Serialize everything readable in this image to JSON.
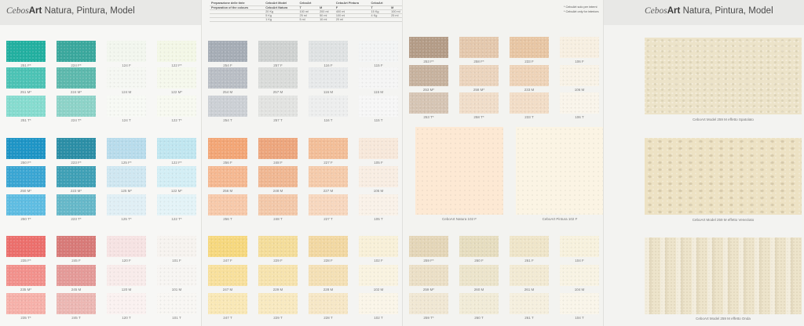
{
  "brand": {
    "logo": "Cebos",
    "art": "Art",
    "rest": " Natura, Pintura, Model"
  },
  "prep": {
    "rows": [
      [
        "Preparazione delle tinte",
        "CeboArt Model",
        "CeboArt",
        "",
        "CeboArt Pintura",
        "CeboArt",
        ""
      ],
      [
        "Preparation of the colours",
        "CeboArt Natura",
        "T",
        "M",
        "F",
        "T",
        "M"
      ],
      [
        "",
        "20 Kg",
        "100 ml",
        "200 ml",
        "400 ml",
        "15 Kg",
        "100 ml"
      ],
      [
        "",
        "5 Kg",
        "25 ml",
        "50 ml",
        "100 ml",
        "4 Kg",
        "25 ml"
      ],
      [
        "",
        "1 Kg",
        "5 ml",
        "10 ml",
        "20 ml",
        "",
        ""
      ]
    ]
  },
  "notes": [
    "* CeboArt solo per interni",
    "* CeboArt only for interiors"
  ],
  "panel1": [
    {
      "c": "251 F*",
      "col": "#22b0a0"
    },
    {
      "c": "224 F*",
      "col": "#3aa89d"
    },
    {
      "c": "124 F",
      "col": "#f2f6ee"
    },
    {
      "c": "122 F*",
      "col": "#f3f7e6"
    },
    {
      "c": "251 M*",
      "col": "#4cc3b5"
    },
    {
      "c": "224 M*",
      "col": "#5db9ad"
    },
    {
      "c": "124 M",
      "col": "#f5f7f2"
    },
    {
      "c": "122 M*",
      "col": "#f5f8ec"
    },
    {
      "c": "251 T*",
      "col": "#86dccf"
    },
    {
      "c": "224 T*",
      "col": "#8dd3c8"
    },
    {
      "c": "124 T",
      "col": "#f7f9f4"
    },
    {
      "c": "122 T*",
      "col": "#f7f9f0"
    },
    {
      "c": "250 F*",
      "col": "#1e95c6"
    },
    {
      "c": "223 F*",
      "col": "#2b8ea6"
    },
    {
      "c": "125 F*",
      "col": "#b8dcec"
    },
    {
      "c": "122 F*",
      "col": "#c0e6f0"
    },
    {
      "c": "250 M*",
      "col": "#3aa6d3"
    },
    {
      "c": "223 M*",
      "col": "#3fa0b6"
    },
    {
      "c": "125 M*",
      "col": "#cfe7f1"
    },
    {
      "c": "122 M*",
      "col": "#d3eef5"
    },
    {
      "c": "250 T*",
      "col": "#5fbde2"
    },
    {
      "c": "223 T*",
      "col": "#66b8c9"
    },
    {
      "c": "125 T*",
      "col": "#e0eff5"
    },
    {
      "c": "122 T*",
      "col": "#e3f3f7"
    },
    {
      "c": "235 F*",
      "col": "#ec6f6c"
    },
    {
      "c": "245 F",
      "col": "#d87a78"
    },
    {
      "c": "120 F",
      "col": "#f6e3e3"
    },
    {
      "c": "101 F",
      "col": "#f6f3ef"
    },
    {
      "c": "235 M*",
      "col": "#f2918c"
    },
    {
      "c": "245 M",
      "col": "#e49a98"
    },
    {
      "c": "120 M",
      "col": "#f8ebea"
    },
    {
      "c": "101 M",
      "col": "#f7f5f2"
    },
    {
      "c": "235 T*",
      "col": "#f6b1aa"
    },
    {
      "c": "245 T",
      "col": "#ecb7b3"
    },
    {
      "c": "120 T",
      "col": "#faf1f0"
    },
    {
      "c": "101 T",
      "col": "#f8f6f3"
    }
  ],
  "panel2": [
    {
      "c": "254 F",
      "col": "#a6adb6"
    },
    {
      "c": "257 F",
      "col": "#cfd2d1"
    },
    {
      "c": "116 F",
      "col": "#dfe2e3"
    },
    {
      "c": "115 F",
      "col": "#f3f4f4"
    },
    {
      "c": "254 M",
      "col": "#b9bec5"
    },
    {
      "c": "257 M",
      "col": "#dadcda"
    },
    {
      "c": "116 M",
      "col": "#e7e9ea"
    },
    {
      "c": "115 M",
      "col": "#f5f5f5"
    },
    {
      "c": "254 T",
      "col": "#ccd0d5"
    },
    {
      "c": "257 T",
      "col": "#e2e3e1"
    },
    {
      "c": "116 T",
      "col": "#edeeee"
    },
    {
      "c": "115 T",
      "col": "#f6f6f6"
    },
    {
      "c": "256 F",
      "col": "#f3a676"
    },
    {
      "c": "248 F",
      "col": "#eda67d"
    },
    {
      "c": "227 F",
      "col": "#f3be98"
    },
    {
      "c": "105 F",
      "col": "#f7e8da"
    },
    {
      "c": "256 M",
      "col": "#f5b891"
    },
    {
      "c": "248 M",
      "col": "#f0b792"
    },
    {
      "c": "227 M",
      "col": "#f5cbab"
    },
    {
      "c": "105 M",
      "col": "#f8ede2"
    },
    {
      "c": "256 T",
      "col": "#f7c9aa"
    },
    {
      "c": "248 T",
      "col": "#f3c8a9"
    },
    {
      "c": "227 T",
      "col": "#f7d7be"
    },
    {
      "c": "105 T",
      "col": "#f9f1e8"
    },
    {
      "c": "247 F",
      "col": "#f6d87e"
    },
    {
      "c": "229 F",
      "col": "#f4dd9a"
    },
    {
      "c": "228 F",
      "col": "#f2d8a2"
    },
    {
      "c": "102 F",
      "col": "#f8f0d8"
    },
    {
      "c": "247 M",
      "col": "#f8e09c"
    },
    {
      "c": "229 M",
      "col": "#f6e3ae"
    },
    {
      "c": "228 M",
      "col": "#f4e0b5"
    },
    {
      "c": "102 M",
      "col": "#f9f3e0"
    },
    {
      "c": "247 T",
      "col": "#f9e8b6"
    },
    {
      "c": "229 T",
      "col": "#f8e9c0"
    },
    {
      "c": "228 T",
      "col": "#f6e7c6"
    },
    {
      "c": "102 T",
      "col": "#faf5e8"
    }
  ],
  "panel3_top": [
    {
      "c": "253 F*",
      "col": "#b49c87"
    },
    {
      "c": "258 F*",
      "col": "#e4c8ad"
    },
    {
      "c": "233 F",
      "col": "#e8c6a4"
    },
    {
      "c": "106 F",
      "col": "#f7efe1"
    },
    {
      "c": "253 M*",
      "col": "#c7b29e"
    },
    {
      "c": "258 M*",
      "col": "#ebd4bd"
    },
    {
      "c": "233 M",
      "col": "#eed3b8"
    },
    {
      "c": "106 M",
      "col": "#f8f2e6"
    },
    {
      "c": "253 T*",
      "col": "#d6c5b4"
    },
    {
      "c": "258 T*",
      "col": "#f0ddc9"
    },
    {
      "c": "233 T",
      "col": "#f2ddc7"
    },
    {
      "c": "106 T",
      "col": "#f9f4ea"
    }
  ],
  "panel3_big": [
    {
      "c": "CeboArt Natura 102 F",
      "col": "#fde9d4"
    },
    {
      "c": "CeboArt Pintura 102 F",
      "col": "#fbf4e4"
    }
  ],
  "panel3_bottom": [
    {
      "c": "259 F*",
      "col": "#e4d6b8"
    },
    {
      "c": "260 F",
      "col": "#e6ddbf"
    },
    {
      "c": "261 F",
      "col": "#efe5c9"
    },
    {
      "c": "104 F",
      "col": "#f7f1dd"
    },
    {
      "c": "259 M*",
      "col": "#ebdfc6"
    },
    {
      "c": "260 M",
      "col": "#ece4cb"
    },
    {
      "c": "261 M",
      "col": "#f2ead3"
    },
    {
      "c": "104 M",
      "col": "#f8f3e3"
    },
    {
      "c": "259 T*",
      "col": "#f0e7d3"
    },
    {
      "c": "260 T",
      "col": "#f1ebd7"
    },
    {
      "c": "261 T",
      "col": "#f5efde"
    },
    {
      "c": "104 T",
      "col": "#f9f5e9"
    }
  ],
  "panel4_photos": [
    {
      "c": "CeboArt Model 259 M effetto Spatolato"
    },
    {
      "c": "CeboArt Model 259 M effetto Veneziato"
    },
    {
      "c": "CeboArt Model 259 M effetto Onda"
    }
  ]
}
